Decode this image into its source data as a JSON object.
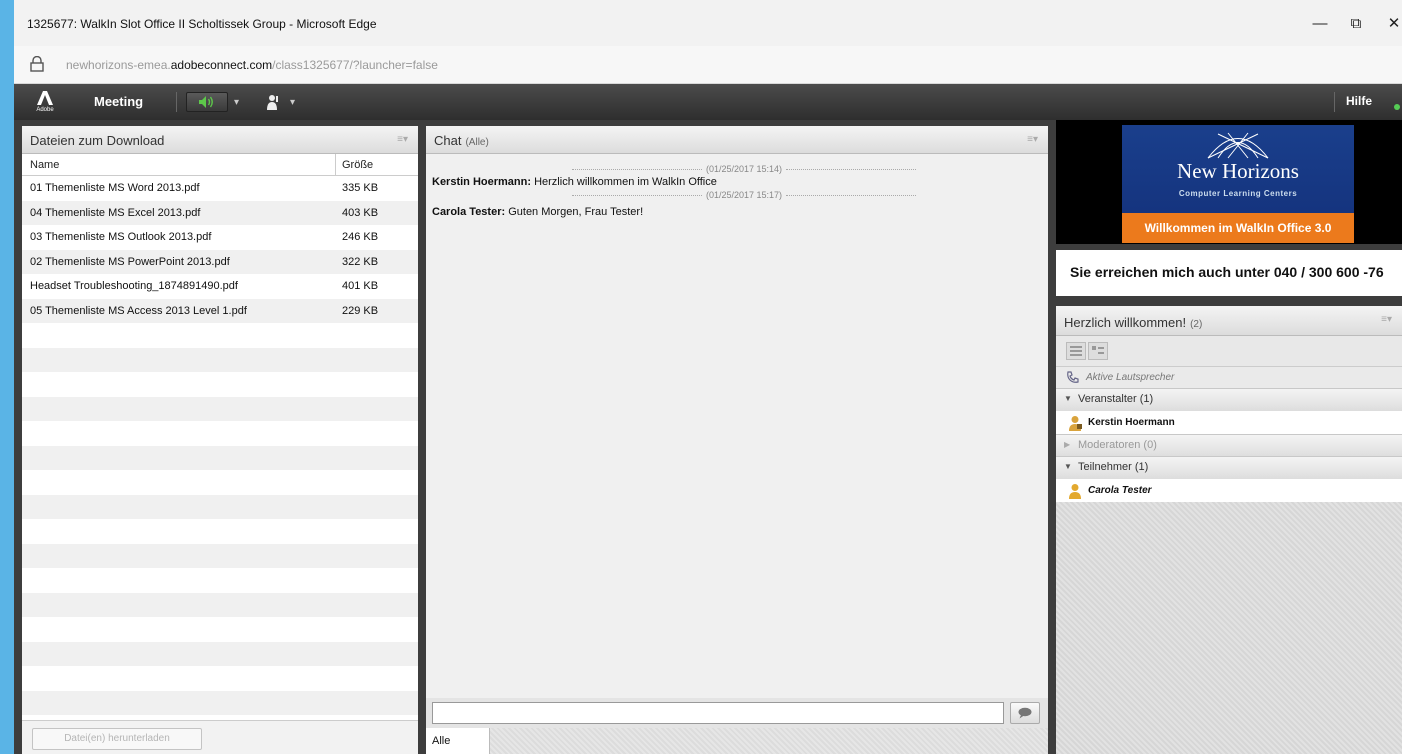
{
  "window": {
    "title": "1325677: WalkIn Slot Office II Scholtissek Group - Microsoft Edge",
    "minimize": "—",
    "restore": "⧉",
    "close": "✕"
  },
  "address": {
    "prefix": "newhorizons-emea.",
    "domain": "adobeconnect.com",
    "path": "/class1325677/?launcher=false"
  },
  "appbar": {
    "logo_text": "Adobe",
    "meeting": "Meeting",
    "help": "Hilfe"
  },
  "files_pod": {
    "title": "Dateien zum Download",
    "menu": "≡▾",
    "col_name": "Name",
    "col_size": "Größe",
    "files": [
      {
        "name": "01 Themenliste MS Word 2013.pdf",
        "size": "335 KB"
      },
      {
        "name": "04 Themenliste MS Excel 2013.pdf",
        "size": "403 KB"
      },
      {
        "name": "03 Themenliste MS Outlook 2013.pdf",
        "size": "246 KB"
      },
      {
        "name": "02 Themenliste MS PowerPoint 2013.pdf",
        "size": "322 KB"
      },
      {
        "name": "Headset Troubleshooting_1874891490.pdf",
        "size": "401 KB"
      },
      {
        "name": "05 Themenliste MS Access 2013 Level  1.pdf",
        "size": "229 KB"
      }
    ],
    "download_button": "Datei(en) herunterladen"
  },
  "chat_pod": {
    "title": "Chat",
    "scope": "(Alle)",
    "menu": "≡▾",
    "messages": [
      {
        "stamp": "(01/25/2017 15:14)",
        "sender": "Kerstin Hoermann:",
        "text": " Herzlich willkommen im WalkIn Office"
      },
      {
        "stamp": "(01/25/2017 15:17)",
        "sender": "Carola Tester:",
        "text": " Guten Morgen, Frau Tester!"
      }
    ],
    "input_value": "",
    "tab": "Alle"
  },
  "banner": {
    "brand": "New Horizons",
    "tagline": "Computer Learning Centers",
    "welcome": "Willkommen im WalkIn Office 3.0"
  },
  "contact": {
    "text": "Sie erreichen mich auch unter 040 / 300 600 -76"
  },
  "attendees_pod": {
    "title": "Herzlich willkommen!",
    "count": "(2)",
    "menu": "≡▾",
    "speakers": "Aktive Lautsprecher",
    "groups": {
      "hosts": "Veranstalter (1)",
      "moderators": "Moderatoren (0)",
      "participants": "Teilnehmer (1)"
    },
    "host_user": "Kerstin Hoermann",
    "participant_user": "Carola Tester"
  },
  "colors": {
    "accent_orange": "#ec7a1c",
    "brand_blue": "#1a3f8c",
    "speaker_green": "#5dc84a"
  }
}
